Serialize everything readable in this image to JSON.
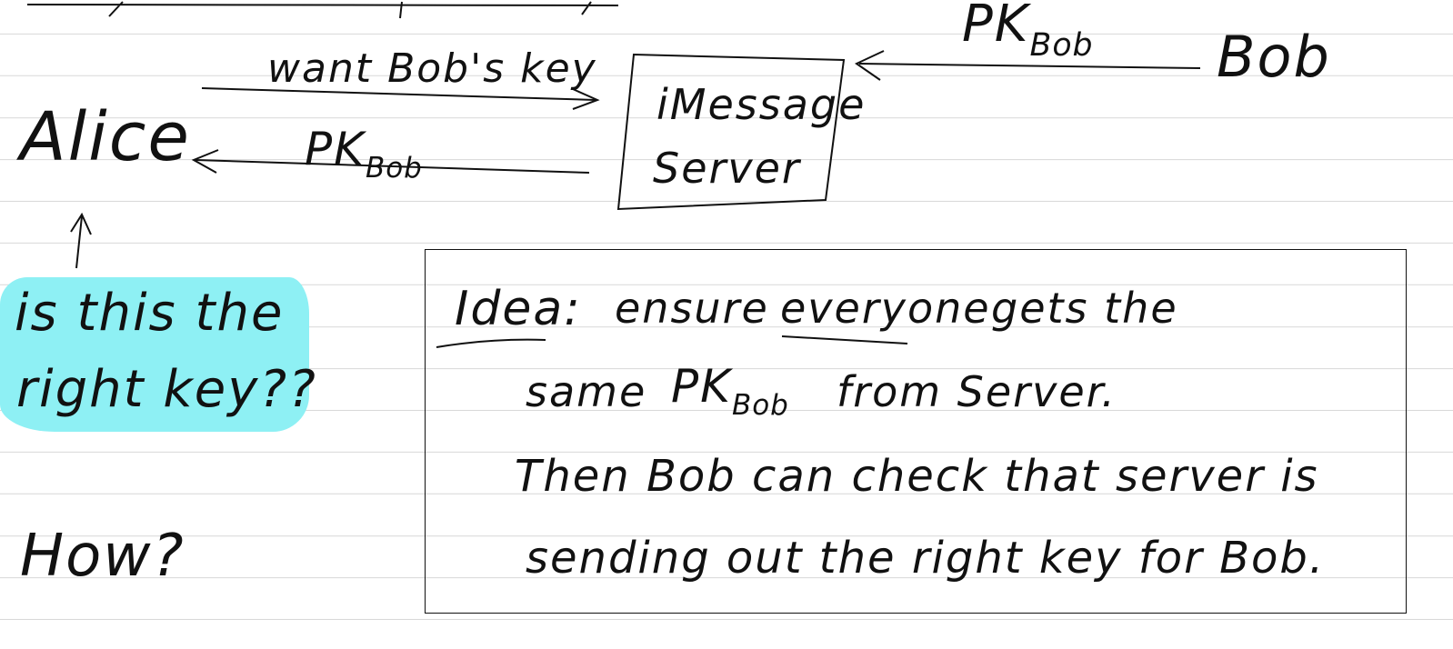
{
  "labels": {
    "alice": "Alice",
    "bob": "Bob",
    "server_line1": "iMessage",
    "server_line2": "Server",
    "request": "want Bob's key",
    "pk_to_alice": "PK",
    "pk_to_alice_sub": "Bob",
    "pk_from_bob": "PK",
    "pk_from_bob_sub": "Bob"
  },
  "question": {
    "line1": "is this the",
    "line2": "right key??",
    "highlight_color": "#8ef0f4"
  },
  "how": "How?",
  "idea": {
    "heading": "Idea:",
    "line1_a": "ensure",
    "line1_emph": "everyone",
    "line1_b": "gets the",
    "line2_a": "same",
    "line2_pk": "PK",
    "line2_pk_sub": "Bob",
    "line2_b": "from Server.",
    "line3": "Then Bob can check that server is",
    "line4": "sending out the right key for Bob."
  }
}
